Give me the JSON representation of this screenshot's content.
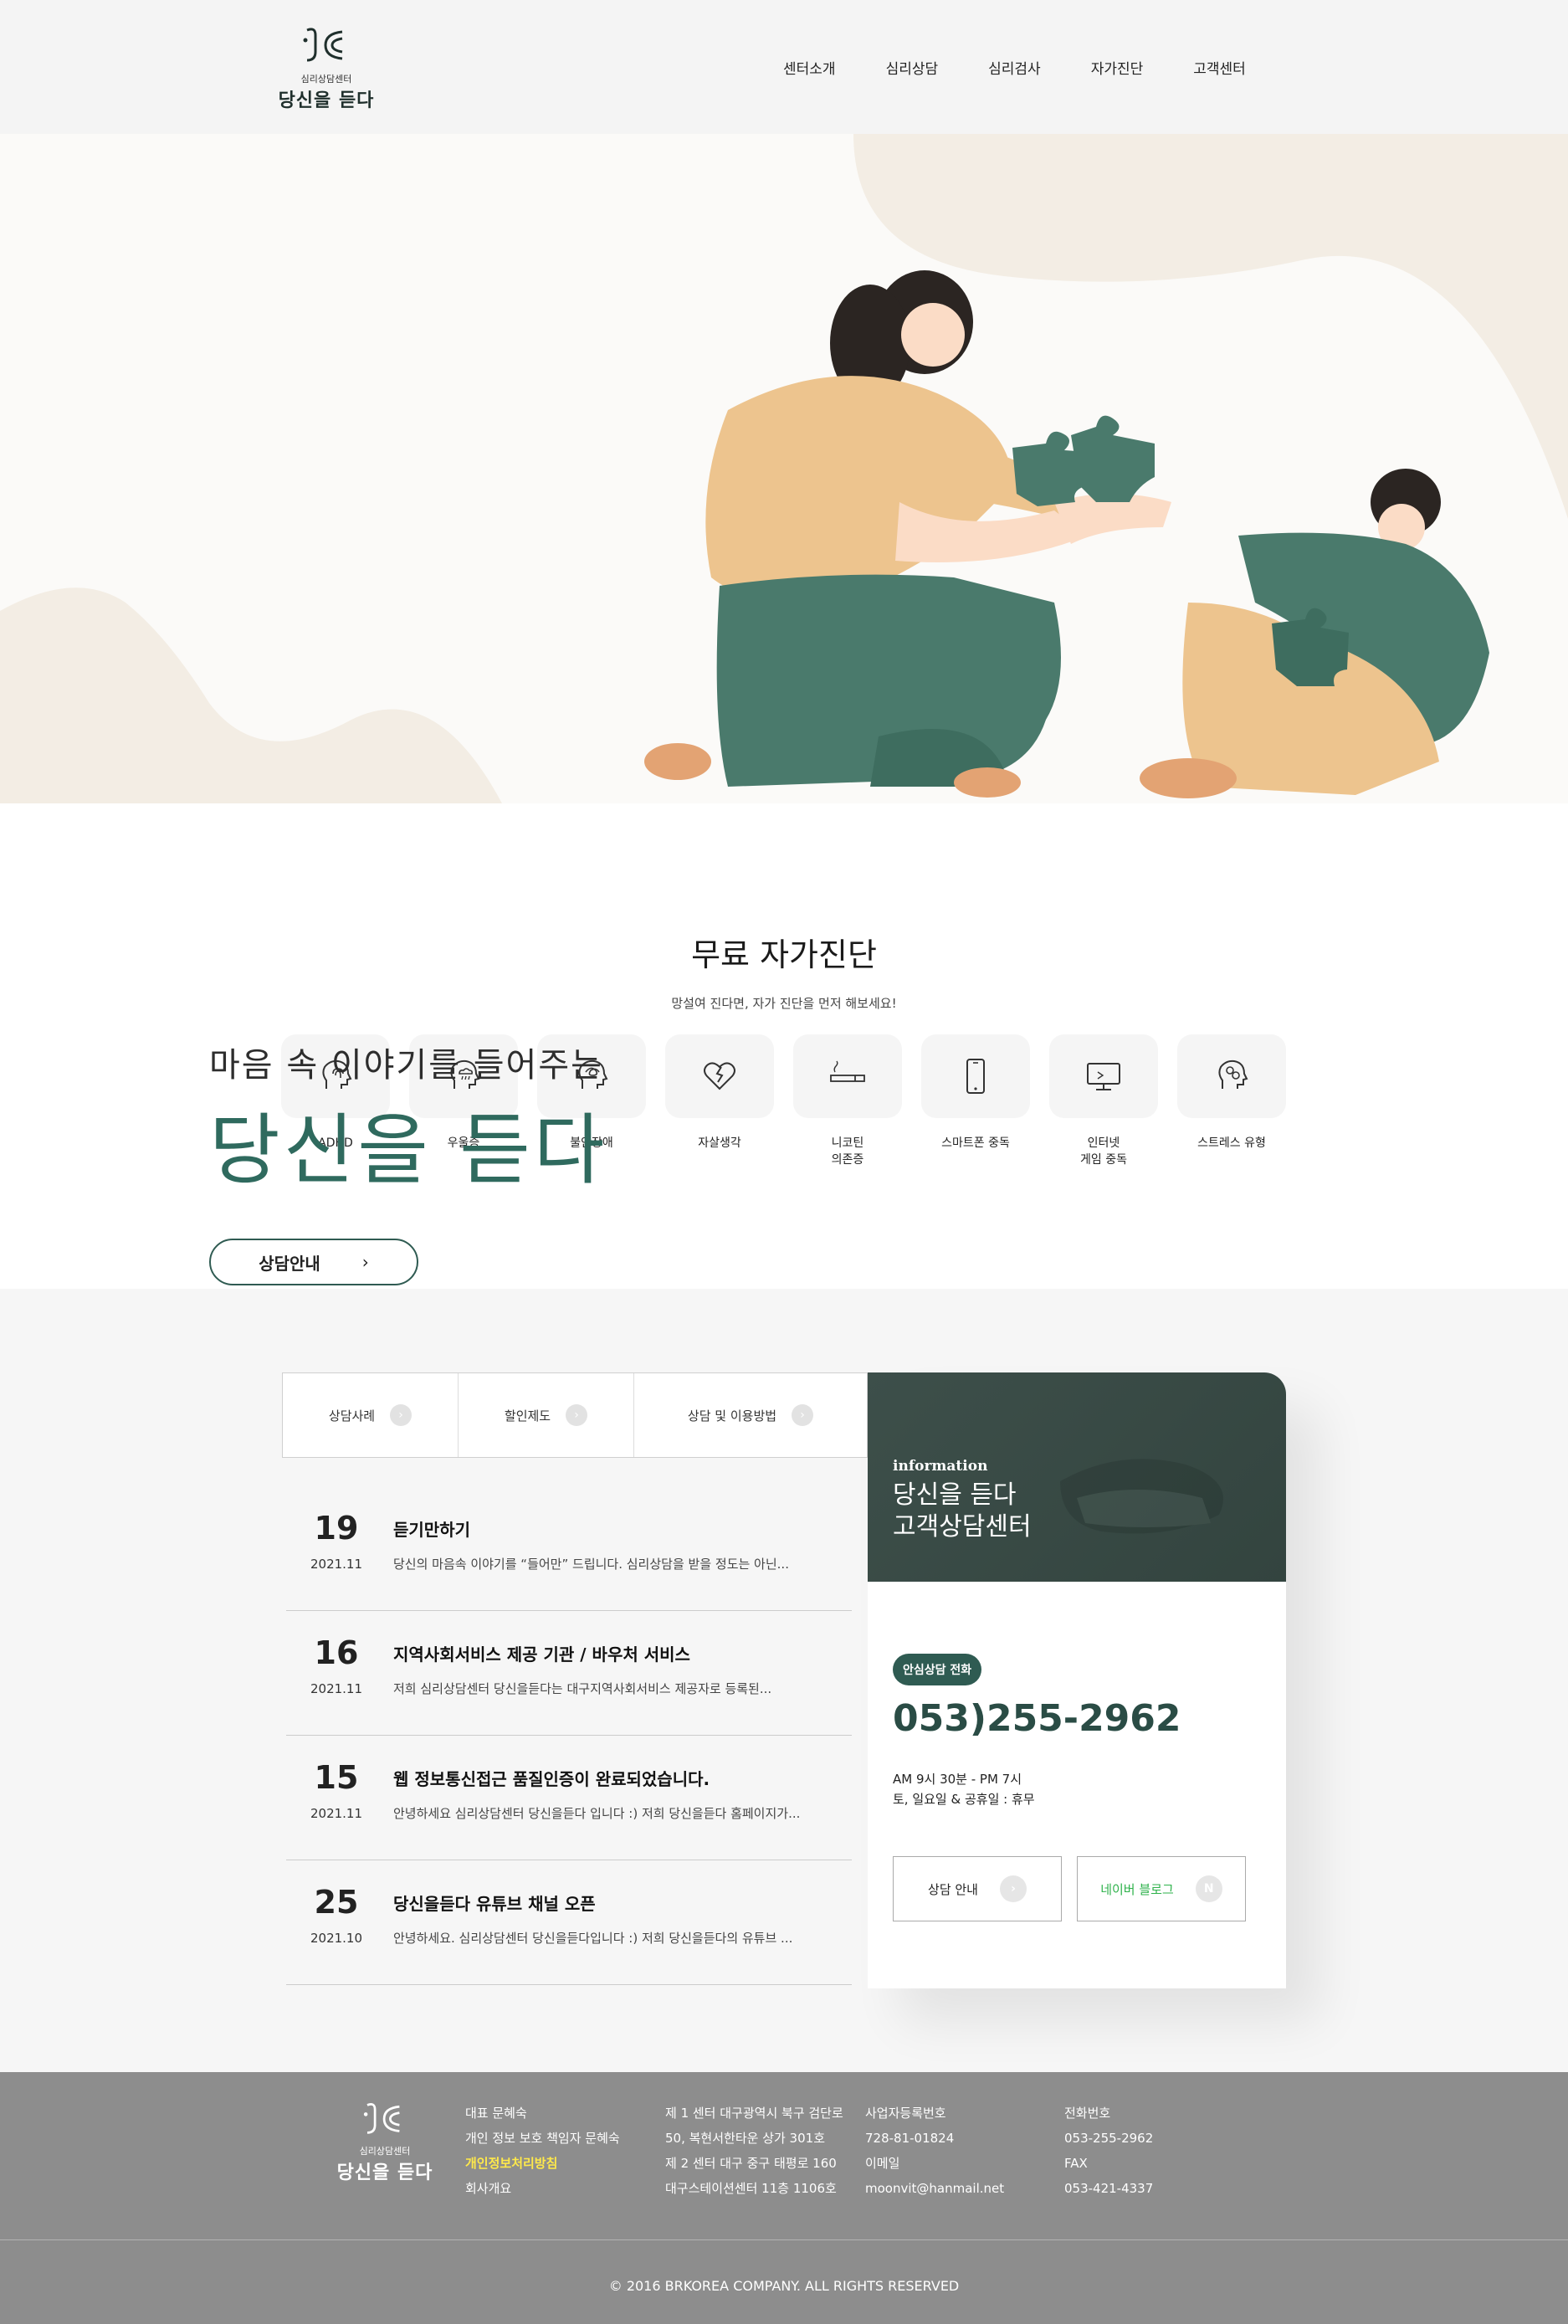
{
  "header": {
    "logo_small": "심리상담센터",
    "logo_big": "당신을 듣다",
    "nav": [
      "센터소개",
      "심리상담",
      "심리검사",
      "자가진단",
      "고객센터"
    ]
  },
  "self_diagnosis": {
    "title": "무료 자가진단",
    "subtitle": "망설여 진다면, 자가 진단을 먼저 해보세요!",
    "items": [
      {
        "label": "ADHD",
        "icon": "head-fingerprint-icon"
      },
      {
        "label": "우울증",
        "icon": "head-cloud-icon"
      },
      {
        "label": "불안장애",
        "icon": "head-tangle-icon"
      },
      {
        "label": "자살생각",
        "icon": "broken-heart-icon"
      },
      {
        "label": "니코틴\n의존증",
        "icon": "cigarette-icon"
      },
      {
        "label": "스마트폰 중독",
        "icon": "smartphone-icon"
      },
      {
        "label": "인터넷\n게임 중독",
        "icon": "monitor-icon"
      },
      {
        "label": "스트레스 유형",
        "icon": "head-gears-icon"
      }
    ]
  },
  "hero_text": {
    "line1": "마음 속 이야기를 들어주는",
    "line2": "당신을 듣다",
    "button": "상담안내",
    "button_arrow": "›"
  },
  "tabs": [
    {
      "label": "상담사례",
      "arrow": "›"
    },
    {
      "label": "할인제도",
      "arrow": "›"
    },
    {
      "label": "상담 및 이용방법",
      "arrow": "›"
    }
  ],
  "news": [
    {
      "day": "19",
      "ym": "2021.11",
      "title": "듣기만하기",
      "desc": "당신의 마음속 이야기를 “들어만” 드립니다. 심리상담을 받을 정도는 아닌..."
    },
    {
      "day": "16",
      "ym": "2021.11",
      "title": "지역사회서비스 제공 기관 / 바우처 서비스",
      "desc": "저희 심리상담센터 당신을듣다는 대구지역사회서비스 제공자로 등록된..."
    },
    {
      "day": "15",
      "ym": "2021.11",
      "title": "웹 정보통신접근 품질인증이 완료되었습니다.",
      "desc": "안녕하세요 심리상담센터 당신을듣다 입니다 :) 저희 당신을듣다 홈페이지가..."
    },
    {
      "day": "25",
      "ym": "2021.10",
      "title": "당신을듣다 유튜브 채널 오픈",
      "desc": "안녕하세요. 심리상담센터 당신을듣다입니다 :) 저희 당신을듣다의 유튜브 ..."
    }
  ],
  "info": {
    "eng": "information",
    "title": "당신을 듣다\n고객상담센터",
    "badge": "안심상담 전화",
    "phone": "053)255-2962",
    "hours": "AM 9시 30분 - PM 7시\n토, 일요일 & 공휴일 : 휴무",
    "btn_consult": "상담 안내",
    "btn_consult_icon": "›",
    "btn_blog": "네이버 블로그",
    "btn_blog_icon": "N"
  },
  "footer": {
    "logo_small": "심리상담센터",
    "logo_big": "당신을 듣다",
    "col1": [
      "대표 문혜숙",
      "개인 정보 보호 책임자 문혜숙",
      "개인정보처리방침",
      "회사개요"
    ],
    "col2": [
      "제 1 센터 대구광역시 북구 검단로",
      "50, 복현서한타운 상가 301호",
      "제 2 센터 대구 중구 태평로 160",
      "대구스테이션센터 11층 1106호"
    ],
    "col3": [
      "사업자등록번호",
      "728-81-01824",
      "이메일",
      "moonvit@hanmail.net"
    ],
    "col4": [
      "전화번호",
      "053-255-2962",
      "FAX",
      "053-421-4337"
    ],
    "copyright": "© 2016 BRKOREA COMPANY. ALL RIGHTS RESERVED"
  },
  "colors": {
    "brand_green": "#2f5b52",
    "accent_green": "#4a7a6c",
    "mustard": "#edc48e",
    "footer_gray": "#8d8d8d",
    "highlight_yellow": "#ffe94a"
  }
}
